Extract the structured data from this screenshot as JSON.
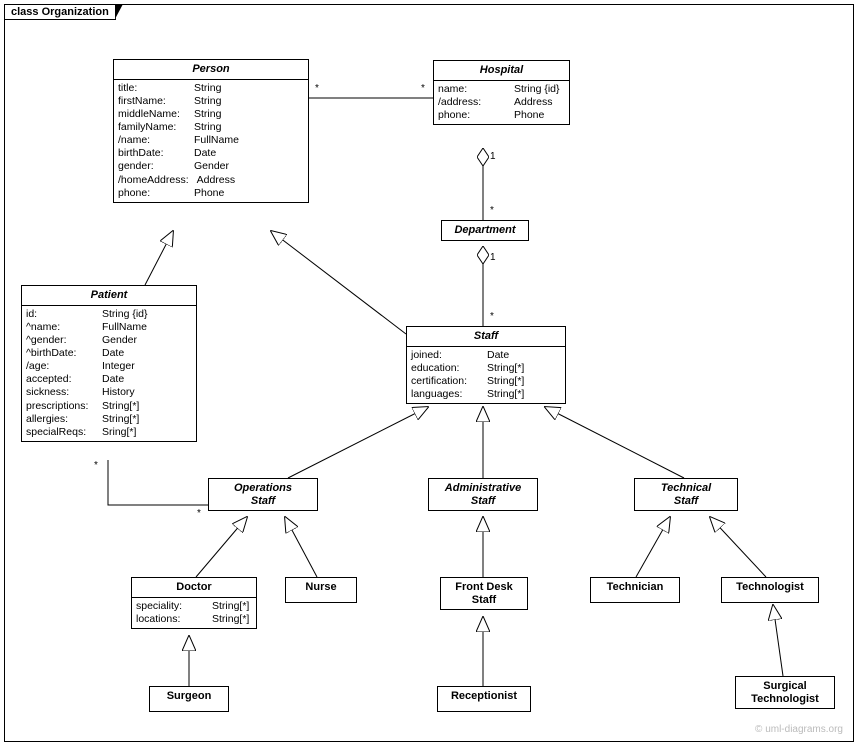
{
  "frame_label": "class Organization",
  "watermark": "© uml-diagrams.org",
  "classes": {
    "person": {
      "title": "Person",
      "attrs": [
        {
          "name": "title:",
          "type": "String"
        },
        {
          "name": "firstName:",
          "type": "String"
        },
        {
          "name": "middleName:",
          "type": "String"
        },
        {
          "name": "familyName:",
          "type": "String"
        },
        {
          "name": "/name:",
          "type": "FullName"
        },
        {
          "name": "birthDate:",
          "type": "Date"
        },
        {
          "name": "gender:",
          "type": "Gender"
        },
        {
          "name": "/homeAddress:",
          "type": "Address"
        },
        {
          "name": "phone:",
          "type": "Phone"
        }
      ]
    },
    "hospital": {
      "title": "Hospital",
      "attrs": [
        {
          "name": "name:",
          "type": "String {id}"
        },
        {
          "name": "/address:",
          "type": "Address"
        },
        {
          "name": "phone:",
          "type": "Phone"
        }
      ]
    },
    "department": {
      "title": "Department"
    },
    "patient": {
      "title": "Patient",
      "attrs": [
        {
          "name": "id:",
          "type": "String {id}"
        },
        {
          "name": "^name:",
          "type": "FullName"
        },
        {
          "name": "^gender:",
          "type": "Gender"
        },
        {
          "name": "^birthDate:",
          "type": "Date"
        },
        {
          "name": "/age:",
          "type": "Integer"
        },
        {
          "name": "accepted:",
          "type": "Date"
        },
        {
          "name": "sickness:",
          "type": "History"
        },
        {
          "name": "prescriptions:",
          "type": "String[*]"
        },
        {
          "name": "allergies:",
          "type": "String[*]"
        },
        {
          "name": "specialReqs:",
          "type": "Sring[*]"
        }
      ]
    },
    "staff": {
      "title": "Staff",
      "attrs": [
        {
          "name": "joined:",
          "type": "Date"
        },
        {
          "name": "education:",
          "type": "String[*]"
        },
        {
          "name": "certification:",
          "type": "String[*]"
        },
        {
          "name": "languages:",
          "type": "String[*]"
        }
      ]
    },
    "operations_staff": {
      "title": "Operations\nStaff"
    },
    "administrative_staff": {
      "title": "Administrative\nStaff"
    },
    "technical_staff": {
      "title": "Technical\nStaff"
    },
    "doctor": {
      "title": "Doctor",
      "attrs": [
        {
          "name": "speciality:",
          "type": "String[*]"
        },
        {
          "name": "locations:",
          "type": "String[*]"
        }
      ]
    },
    "nurse": {
      "title": "Nurse"
    },
    "front_desk_staff": {
      "title": "Front Desk\nStaff"
    },
    "technician": {
      "title": "Technician"
    },
    "technologist": {
      "title": "Technologist"
    },
    "surgeon": {
      "title": "Surgeon"
    },
    "receptionist": {
      "title": "Receptionist"
    },
    "surgical_technologist": {
      "title": "Surgical\nTechnologist"
    }
  },
  "multiplicities": {
    "person_hospital_left": "*",
    "person_hospital_right": "*",
    "hospital_department_top": "1",
    "hospital_department_bottom": "*",
    "department_staff_top": "1",
    "department_staff_bottom": "*",
    "patient_operations_left": "*",
    "patient_operations_right": "*"
  }
}
